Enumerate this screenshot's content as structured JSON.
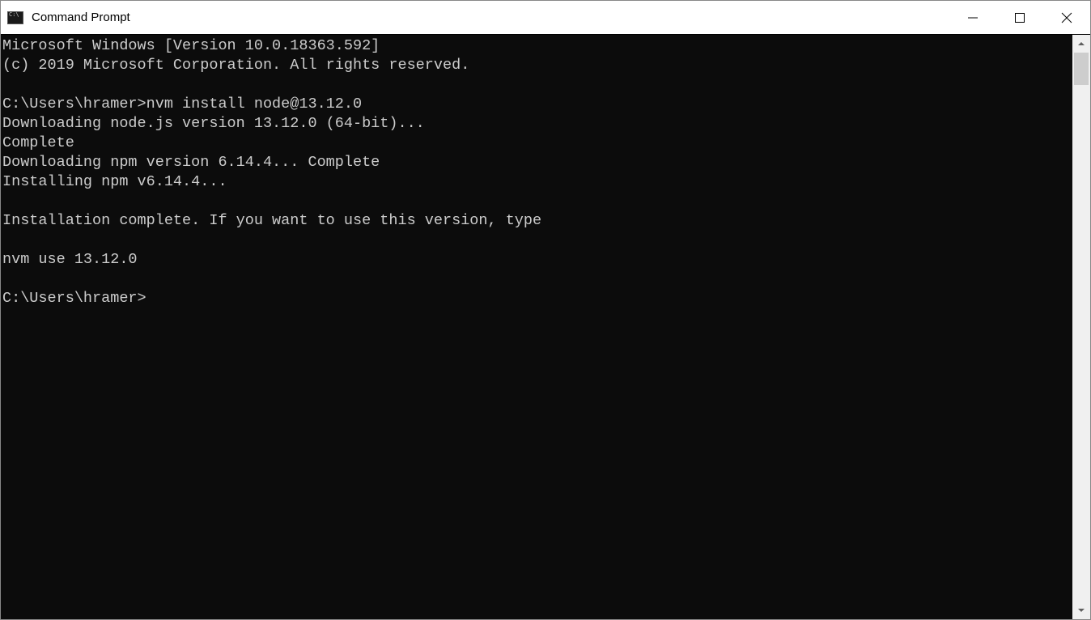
{
  "window": {
    "title": "Command Prompt"
  },
  "terminal": {
    "lines": [
      "Microsoft Windows [Version 10.0.18363.592]",
      "(c) 2019 Microsoft Corporation. All rights reserved.",
      "",
      "C:\\Users\\hramer>nvm install node@13.12.0",
      "Downloading node.js version 13.12.0 (64-bit)...",
      "Complete",
      "Downloading npm version 6.14.4... Complete",
      "Installing npm v6.14.4...",
      "",
      "Installation complete. If you want to use this version, type",
      "",
      "nvm use 13.12.0",
      "",
      "C:\\Users\\hramer>"
    ]
  }
}
